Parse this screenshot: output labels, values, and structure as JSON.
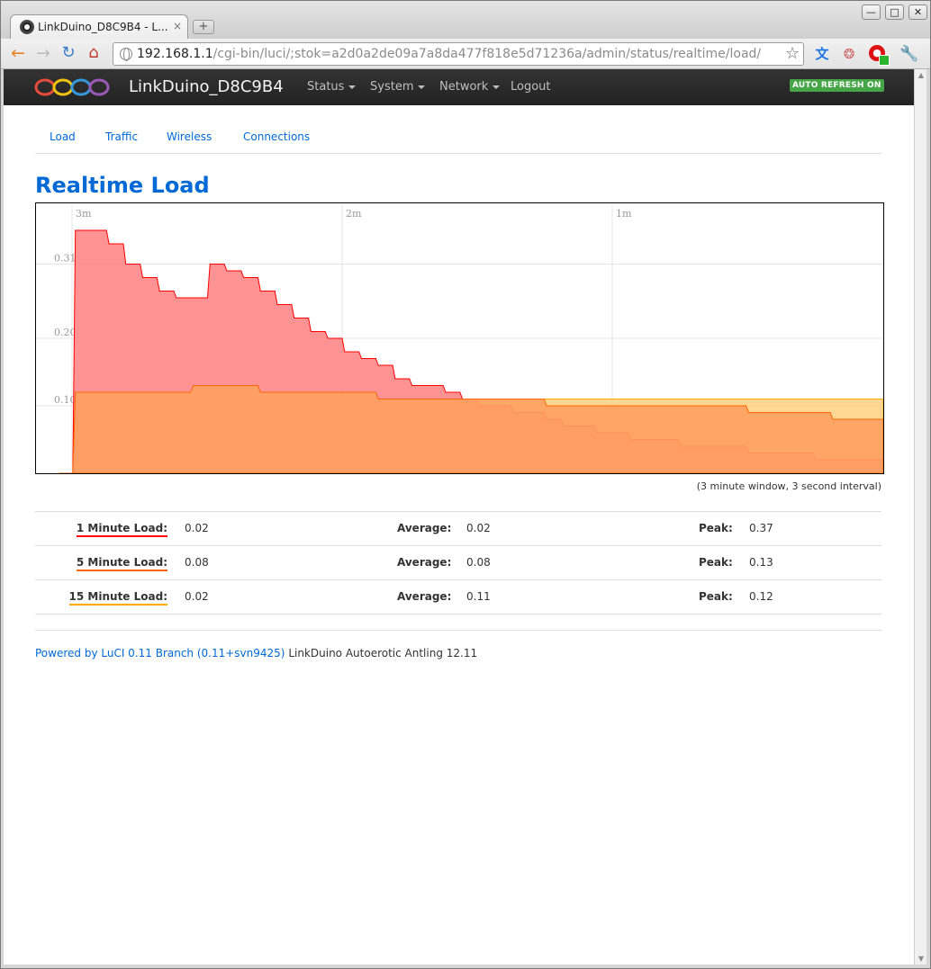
{
  "browser": {
    "tab_title": "LinkDuino_D8C9B4 - L...",
    "tab_close": "×",
    "new_tab": "+",
    "win_min": "—",
    "win_max": "□",
    "win_close": "✕",
    "url_host": "192.168.1.1",
    "url_path": "/cgi-bin/luci/;stok=a2d0a2de09a7a8da477f818e5d71236a/admin/status/realtime/load/"
  },
  "navbar": {
    "brand": "LinkDuino_D8C9B4",
    "menu": [
      {
        "label": "Status"
      },
      {
        "label": "System"
      },
      {
        "label": "Network"
      },
      {
        "label": "Logout"
      }
    ],
    "auto_refresh": "AUTO REFRESH ON"
  },
  "tabs": [
    "Load",
    "Traffic",
    "Wireless",
    "Connections"
  ],
  "page_title": "Realtime Load",
  "chart_data": {
    "type": "area",
    "title": "",
    "x_axis_labels": [
      "3m",
      "2m",
      "1m"
    ],
    "y_axis_labels": [
      "0.31",
      "0.20",
      "0.10"
    ],
    "ylim": [
      0,
      0.4
    ],
    "grid": true,
    "note": "(3 minute window, 3 second interval)",
    "series": [
      {
        "name": "1 Minute Load",
        "color": "#ff0000",
        "fill": "#ff8080",
        "values": [
          0,
          0.36,
          0.36,
          0.34,
          0.31,
          0.29,
          0.27,
          0.26,
          0.26,
          0.31,
          0.3,
          0.29,
          0.27,
          0.25,
          0.23,
          0.21,
          0.2,
          0.18,
          0.17,
          0.16,
          0.14,
          0.13,
          0.13,
          0.12,
          0.11,
          0.1,
          0.1,
          0.09,
          0.09,
          0.08,
          0.07,
          0.07,
          0.06,
          0.06,
          0.05,
          0.05,
          0.05,
          0.04,
          0.04,
          0.04,
          0.04,
          0.03,
          0.03,
          0.03,
          0.03,
          0.02,
          0.02,
          0.02,
          0.02,
          0.02
        ]
      },
      {
        "name": "5 Minute Load",
        "color": "#ff6600",
        "fill": "#ffa060",
        "values": [
          0,
          0.12,
          0.12,
          0.12,
          0.12,
          0.12,
          0.12,
          0.12,
          0.13,
          0.13,
          0.13,
          0.13,
          0.12,
          0.12,
          0.12,
          0.12,
          0.12,
          0.12,
          0.12,
          0.11,
          0.11,
          0.11,
          0.11,
          0.11,
          0.11,
          0.11,
          0.11,
          0.11,
          0.11,
          0.1,
          0.1,
          0.1,
          0.1,
          0.1,
          0.1,
          0.1,
          0.1,
          0.1,
          0.1,
          0.1,
          0.1,
          0.09,
          0.09,
          0.09,
          0.09,
          0.09,
          0.08,
          0.08,
          0.08,
          0.08
        ]
      },
      {
        "name": "15 Minute Load",
        "color": "#ffaa00",
        "fill": "#ffd080",
        "values": [
          0,
          0.11,
          0.11,
          0.11,
          0.11,
          0.11,
          0.11,
          0.11,
          0.11,
          0.11,
          0.11,
          0.11,
          0.11,
          0.11,
          0.11,
          0.11,
          0.11,
          0.11,
          0.11,
          0.11,
          0.11,
          0.11,
          0.11,
          0.11,
          0.11,
          0.11,
          0.11,
          0.11,
          0.11,
          0.11,
          0.11,
          0.11,
          0.11,
          0.11,
          0.11,
          0.11,
          0.11,
          0.11,
          0.11,
          0.11,
          0.11,
          0.11,
          0.11,
          0.11,
          0.11,
          0.11,
          0.11,
          0.11,
          0.11,
          0.11
        ]
      }
    ]
  },
  "stats": [
    {
      "label": "1 Minute Load:",
      "color": "#ff0000",
      "current": "0.02",
      "avg_label": "Average:",
      "average": "0.02",
      "peak_label": "Peak:",
      "peak": "0.37"
    },
    {
      "label": "5 Minute Load:",
      "color": "#ff6600",
      "current": "0.08",
      "avg_label": "Average:",
      "average": "0.08",
      "peak_label": "Peak:",
      "peak": "0.13"
    },
    {
      "label": "15 Minute Load:",
      "color": "#ffaa00",
      "current": "0.02",
      "avg_label": "Average:",
      "average": "0.11",
      "peak_label": "Peak:",
      "peak": "0.12"
    }
  ],
  "footer": {
    "link": "Powered by LuCI 0.11 Branch (0.11+svn9425)",
    "text": " LinkDuino Autoerotic Antling 12.11"
  }
}
